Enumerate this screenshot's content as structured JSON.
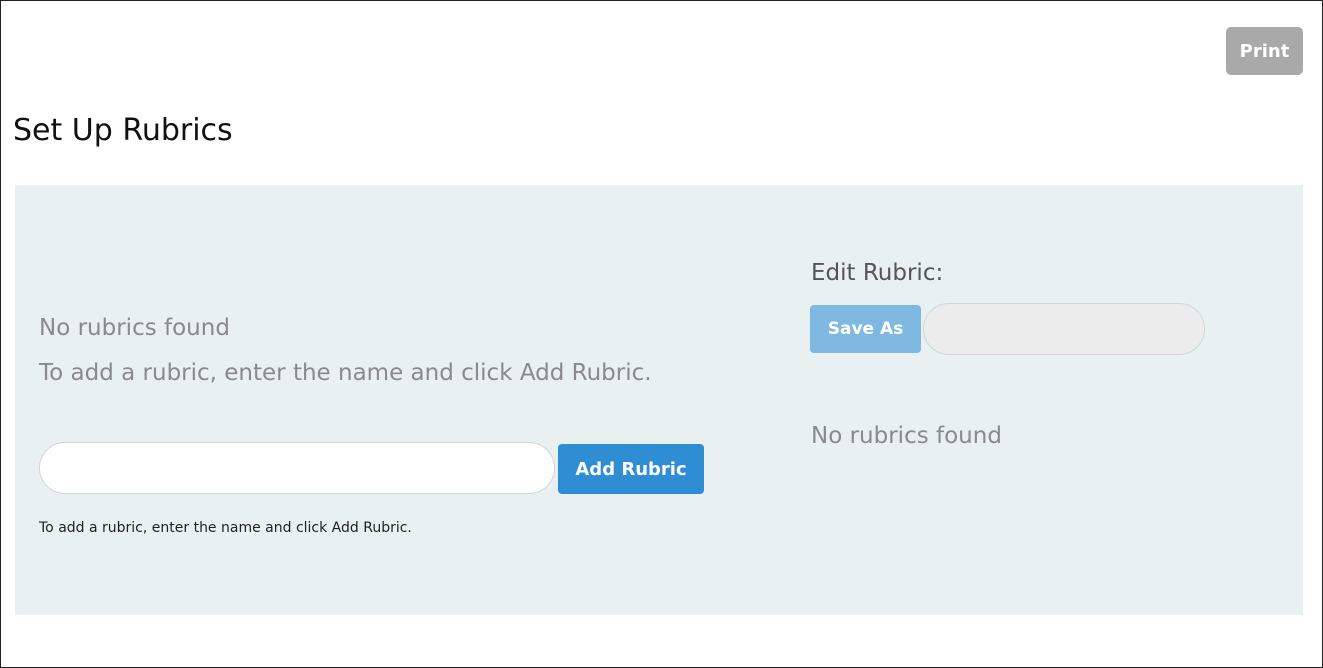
{
  "header": {
    "print_label": "Print",
    "title": "Set Up Rubrics"
  },
  "left": {
    "empty_message": "No rubrics found",
    "instructions": "To add a rubric, enter the name and click Add Rubric.",
    "name_input": {
      "value": "",
      "placeholder": ""
    },
    "add_button_label": "Add Rubric",
    "help_text": "To add a rubric, enter the name and click Add Rubric."
  },
  "right": {
    "edit_label": "Edit Rubric:",
    "save_as_label": "Save As",
    "save_as_input": {
      "value": "",
      "placeholder": ""
    },
    "empty_message": "No rubrics found"
  },
  "colors": {
    "panel_bg": "#e8f0f2",
    "primary_button": "#2f8ed3",
    "disabled_button": "#7fb9e2",
    "print_button": "#a9a9a9"
  }
}
